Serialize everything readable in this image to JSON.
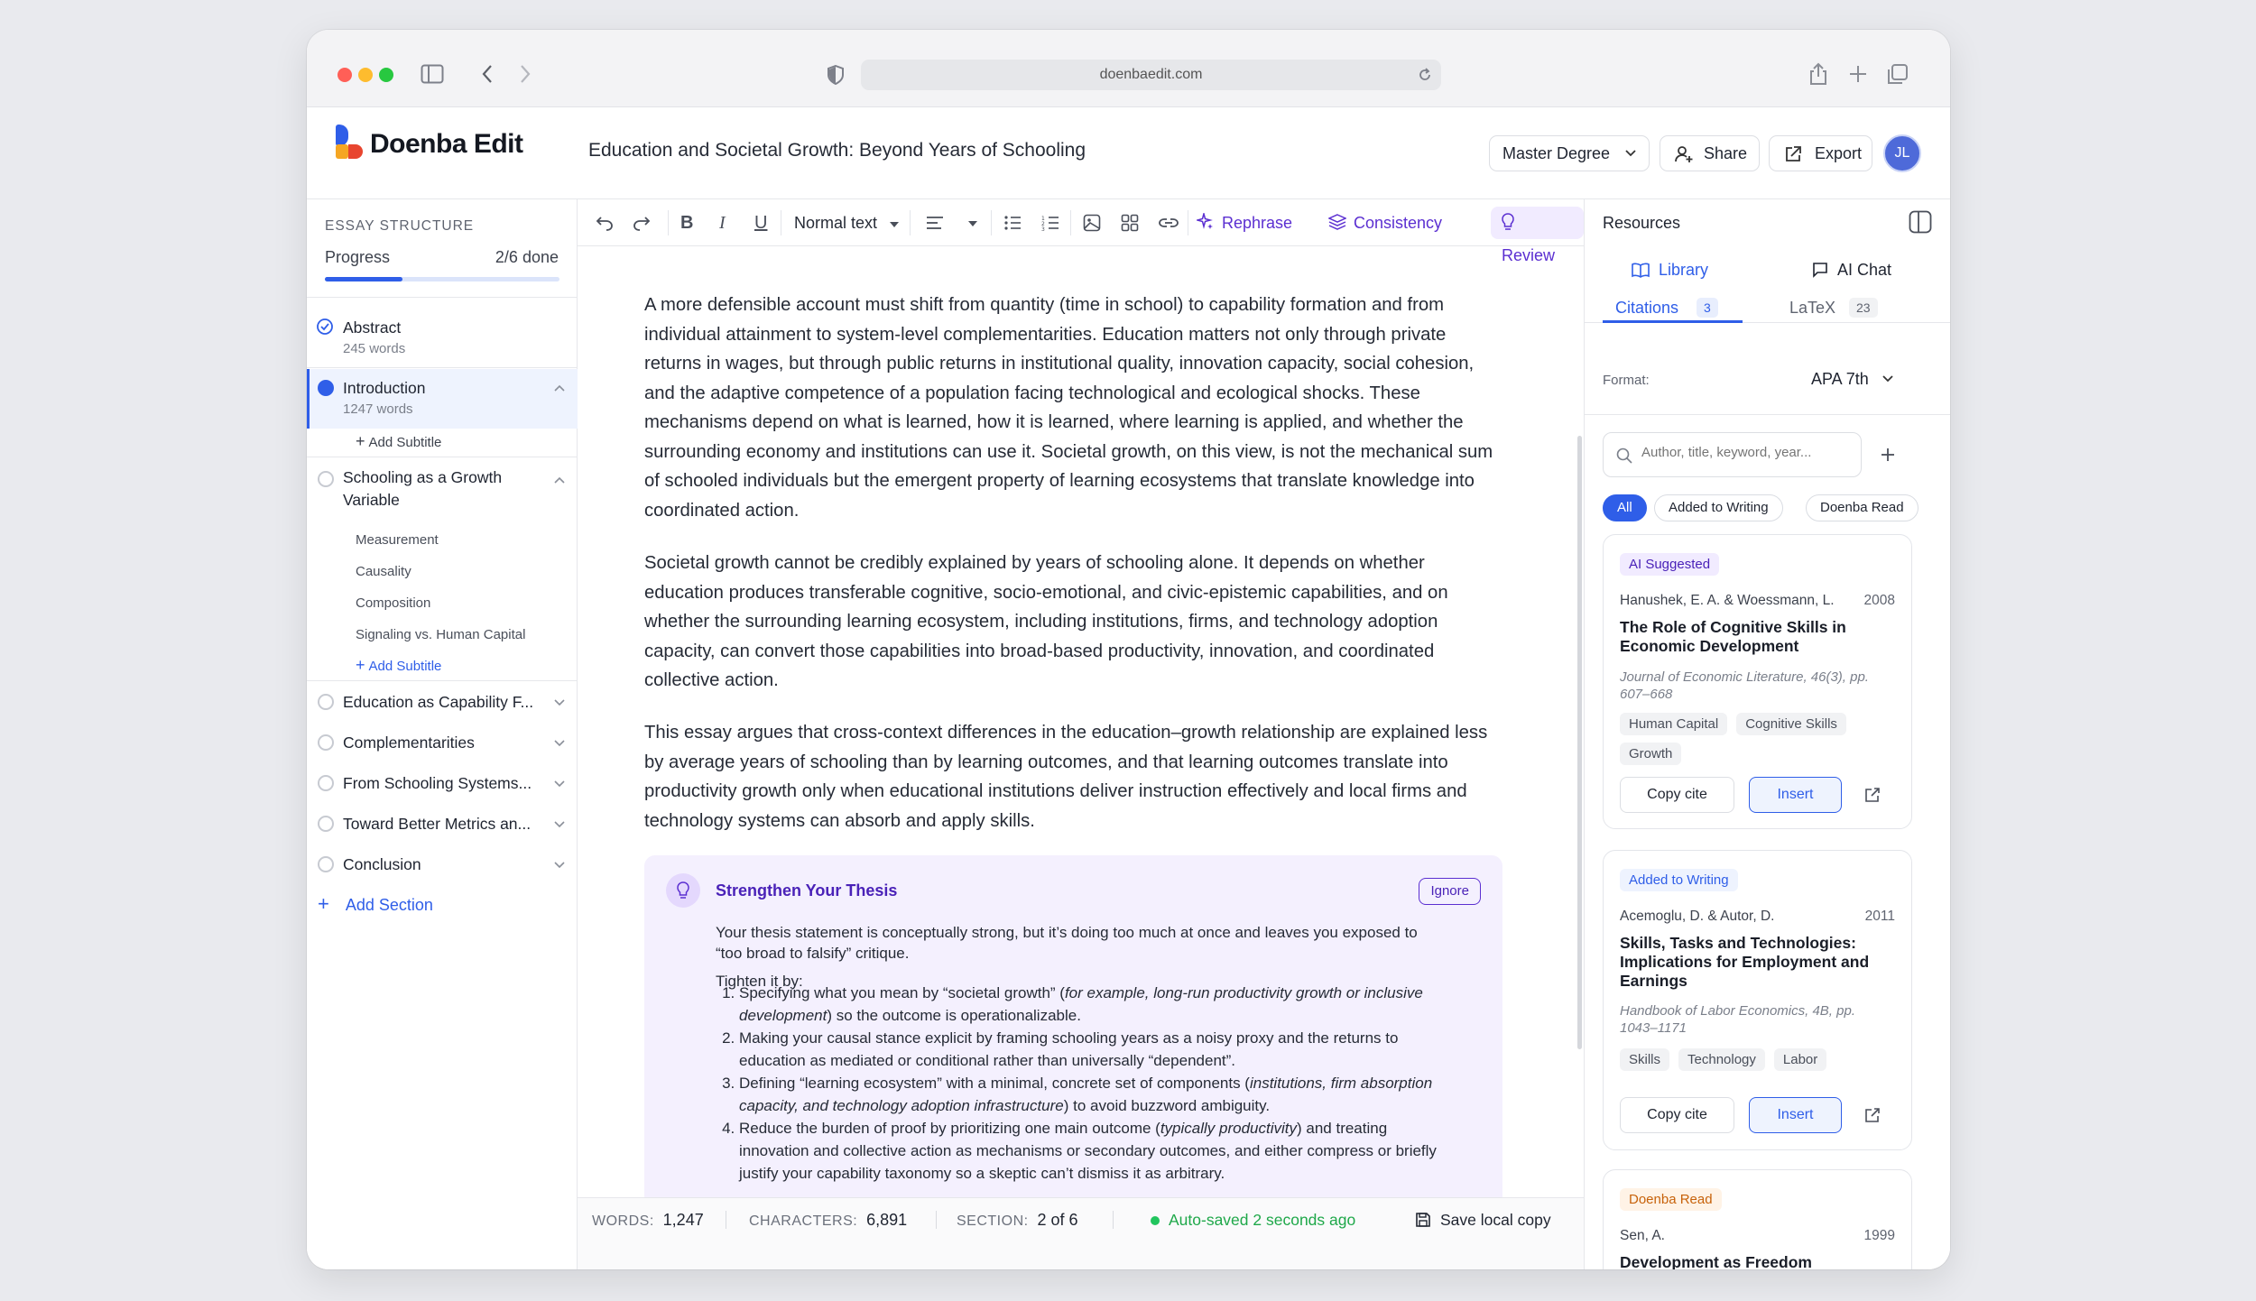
{
  "browser": {
    "url": "doenbaedit.com"
  },
  "app": {
    "logo_text": "Doenba Edit",
    "document_title": "Education and Societal Growth: Beyond Years of Schooling",
    "degree_select": "Master Degree",
    "share_label": "Share",
    "export_label": "Export",
    "avatar_initials": "JL"
  },
  "sidebar": {
    "heading": "ESSAY STRUCTURE",
    "progress_label": "Progress",
    "progress_value": "2/6 done",
    "progress_fraction": 0.33,
    "sections": [
      {
        "title": "Abstract",
        "words": "245 words"
      },
      {
        "title": "Introduction",
        "words": "1247 words",
        "add_subtitle": "Add Subtitle"
      },
      {
        "title_line1": "Schooling as a Growth",
        "title_line2": "Variable",
        "subitems": [
          "Measurement",
          "Causality",
          "Composition",
          "Signaling vs. Human Capital"
        ],
        "add_subtitle": "Add Subtitle"
      },
      {
        "title": "Education as Capability F..."
      },
      {
        "title": "Complementarities"
      },
      {
        "title": "From Schooling Systems..."
      },
      {
        "title": "Toward Better Metrics an..."
      },
      {
        "title": "Conclusion"
      }
    ],
    "add_section": "Add Section"
  },
  "toolbar": {
    "text_style": "Normal text",
    "rephrase": "Rephrase",
    "consistency": "Consistency",
    "review": "Review"
  },
  "editor": {
    "paragraphs": [
      "A more defensible account must shift from quantity (time in school) to capability formation and from individual attainment to system-level complementarities. Education matters not only through private returns in wages, but through public returns in institutional quality, innovation capacity, social cohesion, and the adaptive competence of a population facing technological and ecological shocks. These mechanisms depend on what is learned, how it is learned, where learning is applied, and whether the surrounding economy and institutions can use it. Societal growth, on this view, is not the mechanical sum of schooled individuals but the emergent property of learning ecosystems that translate knowledge into coordinated action.",
      "Societal growth cannot be credibly explained by years of schooling alone. It depends on whether education produces transferable cognitive, socio-emotional, and civic-epistemic capabilities, and on whether the surrounding learning ecosystem, including institutions, firms, and technology adoption capacity, can convert those capabilities into broad-based productivity, innovation, and coordinated collective action.",
      "This essay argues that cross-context differences in the education–growth relationship are explained less by average years of schooling than by learning outcomes, and that learning outcomes translate into productivity growth only when educational institutions deliver instruction effectively and local firms and technology systems can absorb and apply skills."
    ],
    "suggestion": {
      "title": "Strengthen Your Thesis",
      "ignore": "Ignore",
      "intro": "Your thesis statement is conceptually strong, but it’s doing too much at once and leaves you exposed to “too broad to falsify” critique.",
      "tighten": "Tighten it by:",
      "items": [
        {
          "a": "Specifying what you mean by “societal growth” (",
          "em": "for example, long-run productivity growth or inclusive development",
          "b": ") so the outcome is operationalizable."
        },
        {
          "a": "Making your causal stance explicit by framing schooling years as a noisy proxy and the returns to education as mediated or conditional rather than universally “dependent”.",
          "em": "",
          "b": ""
        },
        {
          "a": "Defining “learning ecosystem” with a minimal, concrete set of components (",
          "em": "institutions, firm absorption capacity, and technology adoption infrastructure",
          "b": ") to avoid buzzword ambiguity."
        },
        {
          "a": "Reduce the burden of proof by prioritizing one main outcome (",
          "em": "typically productivity",
          "b": ") and treating innovation and collective action as mechanisms or secondary outcomes, and either compress or briefly justify your capability taxonomy so a skeptic can’t dismiss it as arbitrary."
        }
      ]
    }
  },
  "footer": {
    "words_label": "WORDS:",
    "words": "1,247",
    "chars_label": "CHARACTERS:",
    "chars": "6,891",
    "section_label": "SECTION:",
    "section": "2 of 6",
    "autosave": "Auto-saved 2 seconds ago",
    "save_local": "Save local copy"
  },
  "resources": {
    "title": "Resources",
    "tab_library": "Library",
    "tab_ai_chat": "AI Chat",
    "citations_label": "Citations",
    "citations_count": "3",
    "latex_label": "LaTeX",
    "latex_count": "23",
    "format_label": "Format:",
    "format_value": "APA 7th",
    "search_placeholder": "Author, title, keyword, year...",
    "filters": [
      "All",
      "Added to Writing",
      "Doenba Read"
    ],
    "copy_cite": "Copy cite",
    "insert": "Insert",
    "cards": [
      {
        "badge": "AI Suggested",
        "authors": "Hanushek, E. A. & Woessmann, L.",
        "year": "2008",
        "title": "The Role of Cognitive Skills in Economic Development",
        "journal": "Journal of Economic Literature, 46(3), pp. 607–668",
        "tags": [
          "Human Capital",
          "Cognitive Skills",
          "Growth"
        ]
      },
      {
        "badge": "Added to Writing",
        "authors": "Acemoglu, D. & Autor, D.",
        "year": "2011",
        "title": "Skills, Tasks and Technologies: Implications for Employment and Earnings",
        "journal": "Handbook of Labor Economics, 4B, pp. 1043–1171",
        "tags": [
          "Skills",
          "Technology",
          "Labor"
        ]
      },
      {
        "badge": "Doenba Read",
        "authors": "Sen, A.",
        "year": "1999",
        "title": "Development as Freedom"
      }
    ]
  },
  "colors": {
    "accent": "#2f5ee8",
    "purple": "#6b2fd6",
    "green": "#1fa84a"
  }
}
